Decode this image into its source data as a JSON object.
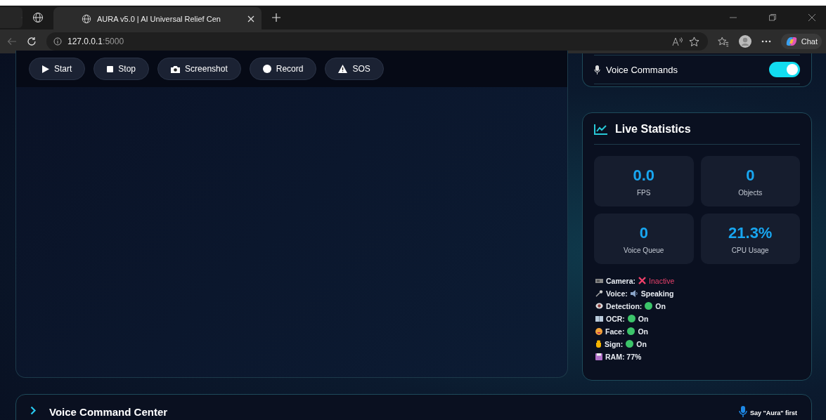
{
  "browser": {
    "tab_title": "AURA v5.0 | AI Universal Relief Cen",
    "address_host": "127.0.0.1",
    "address_port": ":5000",
    "chat_label": "Chat"
  },
  "controls": [
    {
      "kind": "start",
      "label": "Start"
    },
    {
      "kind": "stop",
      "label": "Stop"
    },
    {
      "kind": "screenshot",
      "label": "Screenshot"
    },
    {
      "kind": "record",
      "label": "Record"
    },
    {
      "kind": "sos",
      "label": "SOS"
    }
  ],
  "voice_commands": {
    "label": "Voice Commands",
    "on": true
  },
  "live_statistics": {
    "title": "Live Statistics",
    "stats": [
      {
        "value": "0.0",
        "label": "FPS"
      },
      {
        "value": "0",
        "label": "Objects"
      },
      {
        "value": "0",
        "label": "Voice Queue"
      },
      {
        "value": "21.3%",
        "label": "CPU Usage"
      }
    ],
    "status": [
      {
        "kind": "camera",
        "label": "Camera:",
        "value": {
          "kind": "cross",
          "text": "Inactive",
          "error": true
        }
      },
      {
        "kind": "voice",
        "label": "Voice:",
        "value": {
          "kind": "speaker",
          "text": "Speaking",
          "error": false
        }
      },
      {
        "kind": "detection",
        "label": "Detection:",
        "value": {
          "kind": "dot",
          "text": "On",
          "error": false
        }
      },
      {
        "kind": "ocr",
        "label": "OCR:",
        "value": {
          "kind": "dot",
          "text": "On",
          "error": false
        }
      },
      {
        "kind": "face",
        "label": "Face:",
        "value": {
          "kind": "dot",
          "text": "On",
          "error": false
        }
      },
      {
        "kind": "sign",
        "label": "Sign:",
        "value": {
          "kind": "dot",
          "text": "On",
          "error": false
        }
      },
      {
        "kind": "ram",
        "label": "RAM: 77%"
      }
    ]
  },
  "voice_command_center": {
    "title": "Voice Command Center",
    "expanded": false,
    "hint": "Say \"Aura\" first"
  }
}
